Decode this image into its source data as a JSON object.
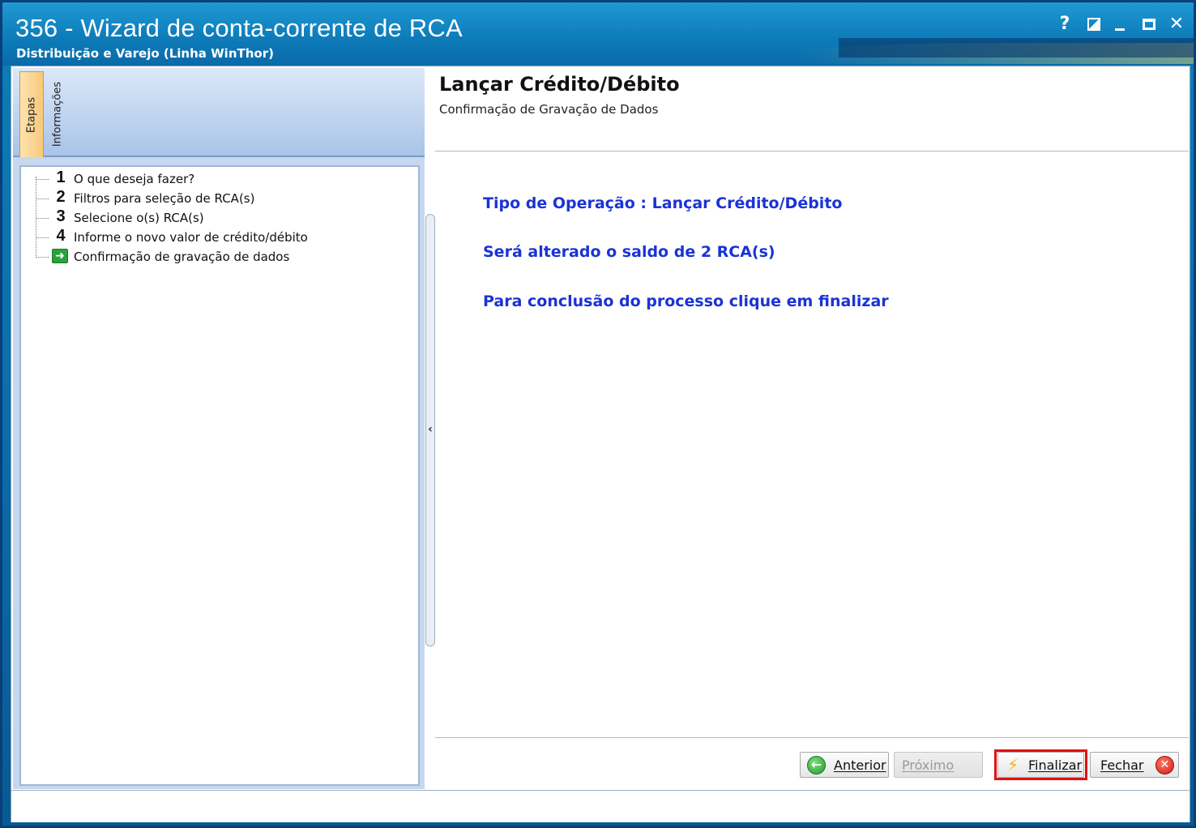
{
  "window": {
    "title": "356 - Wizard de conta-corrente de RCA",
    "subtitle": "Distribuição e Varejo (Linha WinThor)",
    "controls": {
      "help": "?",
      "close": "✕"
    }
  },
  "sidebar": {
    "tabs": [
      {
        "label": "Etapas",
        "active": true
      },
      {
        "label": "Informações",
        "active": false
      }
    ],
    "steps": [
      {
        "number": "1",
        "label": "O que deseja fazer?"
      },
      {
        "number": "2",
        "label": "Filtros para seleção de RCA(s)"
      },
      {
        "number": "3",
        "label": "Selecione o(s) RCA(s)"
      },
      {
        "number": "4",
        "label": "Informe o novo valor de crédito/débito"
      },
      {
        "number": "",
        "label": "Confirmação de gravação de dados",
        "current": true,
        "icon": "green-arrow-icon"
      }
    ]
  },
  "main": {
    "title": "Lançar Crédito/Débito",
    "subtitle": "Confirmação de Gravação de Dados",
    "lines": [
      "Tipo de Operação : Lançar Crédito/Débito",
      "Será alterado o saldo de 2 RCA(s)",
      "Para conclusão do processo clique em finalizar"
    ],
    "line_color": "#1a33d6"
  },
  "buttons": {
    "anterior": {
      "label": "Anterior",
      "icon": "back-arrow-icon",
      "enabled": true
    },
    "proximo": {
      "label": "Próximo",
      "enabled": false
    },
    "finalizar": {
      "label": "Finalizar",
      "icon": "lightning-icon",
      "enabled": true,
      "highlighted": true,
      "highlight_color": "#e01010"
    },
    "fechar": {
      "label": "Fechar",
      "icon": "red-close-icon",
      "enabled": true
    }
  },
  "splitter": {
    "glyph": "‹"
  }
}
